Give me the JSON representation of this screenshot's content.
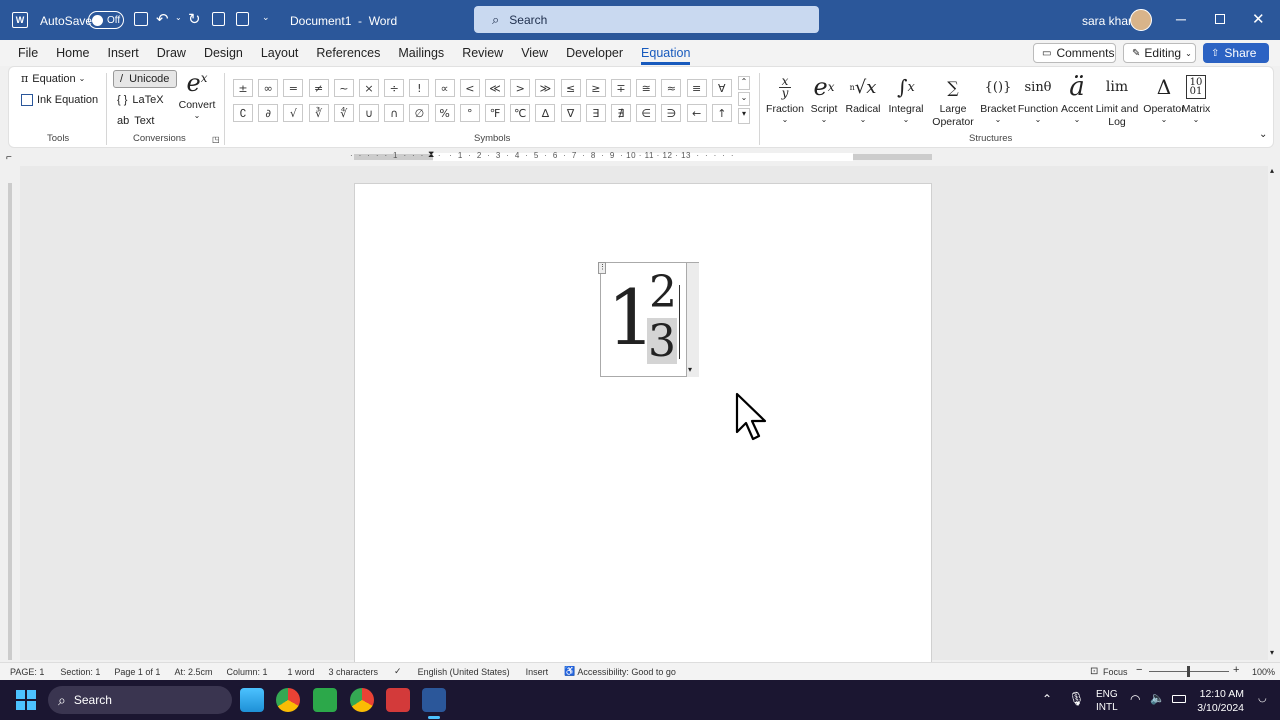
{
  "titlebar": {
    "autosave_label": "AutoSave",
    "autosave_state": "Off",
    "doc_title": "Document1  -  Word",
    "search_placeholder": "Search",
    "user_name": "sara khan"
  },
  "menu": {
    "items": [
      "File",
      "Home",
      "Insert",
      "Draw",
      "Design",
      "Layout",
      "References",
      "Mailings",
      "Review",
      "View",
      "Developer",
      "Equation"
    ],
    "active": "Equation",
    "comments_label": "Comments",
    "editing_label": "Editing",
    "share_label": "Share"
  },
  "ribbon": {
    "tools": {
      "equation_label": "Equation",
      "ink_equation_label": "Ink Equation",
      "group_label": "Tools"
    },
    "conversions": {
      "unicode_label": "Unicode",
      "latex_label": "LaTeX",
      "text_label": "Text",
      "convert_label": "Convert",
      "group_label": "Conversions"
    },
    "symbols": {
      "row1": [
        "±",
        "∞",
        "=",
        "≠",
        "~",
        "×",
        "÷",
        "!",
        "∝",
        "<",
        "≪",
        ">",
        "≫",
        "≤",
        "≥",
        "∓",
        "≅",
        "≈",
        "≡",
        "∀"
      ],
      "row2": [
        "∁",
        "∂",
        "√",
        "∛",
        "∜",
        "∪",
        "∩",
        "∅",
        "%",
        "°",
        "℉",
        "℃",
        "∆",
        "∇",
        "∃",
        "∄",
        "∈",
        "∋",
        "←",
        "↑"
      ],
      "group_label": "Symbols"
    },
    "structures": {
      "items": [
        {
          "label": "Fraction",
          "glyph": "x/y"
        },
        {
          "label": "Script",
          "glyph": "eˣ"
        },
        {
          "label": "Radical",
          "glyph": "ⁿ√x"
        },
        {
          "label": "Integral",
          "glyph": "∫"
        },
        {
          "label": "Large Operator",
          "glyph": "∑"
        },
        {
          "label": "Bracket",
          "glyph": "{()}"
        },
        {
          "label": "Function",
          "glyph": "sinθ"
        },
        {
          "label": "Accent",
          "glyph": "ä"
        },
        {
          "label": "Limit and Log",
          "glyph": "lim"
        },
        {
          "label": "Operator",
          "glyph": "Δ"
        },
        {
          "label": "Matrix",
          "glyph": "[10 01]"
        }
      ],
      "group_label": "Structures"
    }
  },
  "document": {
    "equation_whole": "1",
    "equation_numerator": "2",
    "equation_denominator": "3"
  },
  "statusbar": {
    "page": "PAGE: 1",
    "section": "Section: 1",
    "page_of": "Page 1 of 1",
    "at": "At: 2.5cm",
    "column": "Column: 1",
    "words": "1 word",
    "characters": "3 characters",
    "language": "English (United States)",
    "mode": "Insert",
    "accessibility": "Accessibility: Good to go",
    "focus": "Focus",
    "zoom": "100%"
  },
  "taskbar": {
    "search_label": "Search",
    "lang1": "ENG",
    "lang2": "INTL",
    "time": "12:10 AM",
    "date": "3/10/2024"
  }
}
